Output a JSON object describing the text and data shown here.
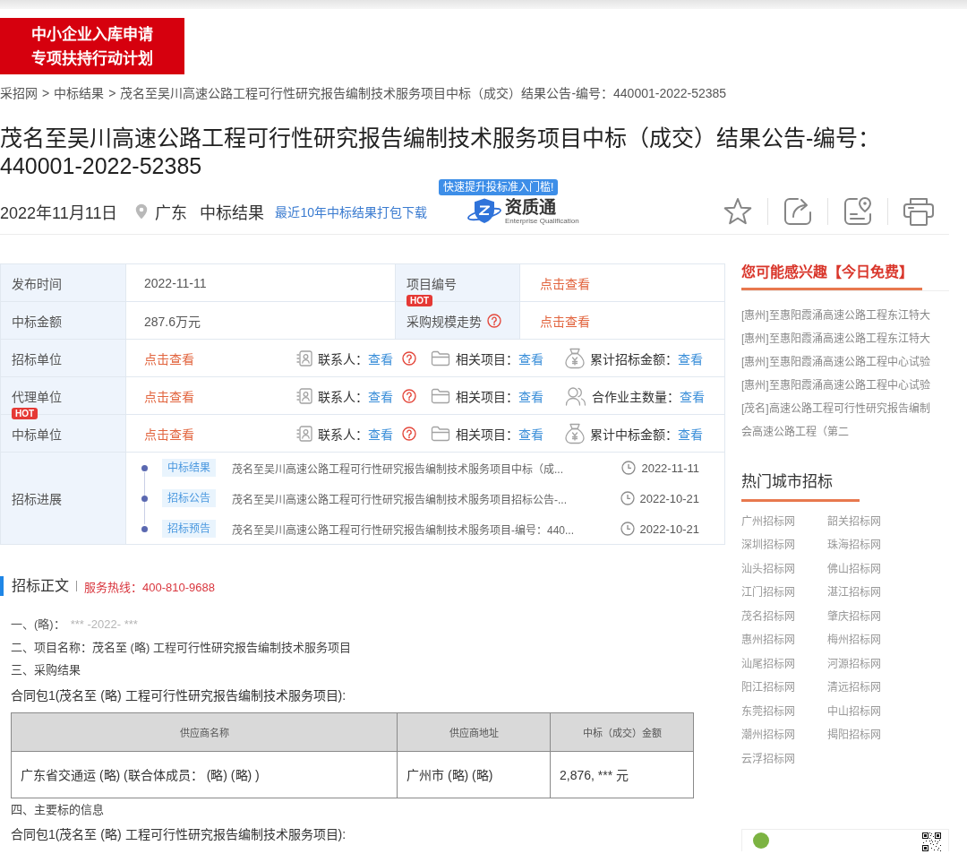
{
  "promo_banner": {
    "lines": [
      "中小企业入库申请",
      "专项扶持行动计划"
    ]
  },
  "breadcrumb": {
    "separator": ">",
    "items": [
      "采招网",
      "中标结果",
      "茂名至吴川高速公路工程可行性研究报告编制技术服务项目中标（成交）结果公告-编号：440001-2022-52385"
    ]
  },
  "title": "茂名至吴川高速公路工程可行性研究报告编制技术服务项目中标（成交）结果公告-编号：440001-2022-52385",
  "meta": {
    "date": "2022年11月11日",
    "region": "广东",
    "category": "中标结果",
    "download_link": "最近10年中标结果打包下载",
    "partner": {
      "tooltip": "快速提升投标准入门槛!",
      "name": "资质通",
      "subtitle": "Enterprise Qualification"
    }
  },
  "info_table": {
    "top_rows": [
      {
        "label": "发布时间",
        "value": "2022-11-11",
        "label_2": "项目编号",
        "link_2": "点击查看"
      },
      {
        "label": "中标金额",
        "value": "287.6万元",
        "badge_2": "HOT",
        "label_2": "采购规模走势",
        "help_2": true,
        "link_2": "点击查看"
      }
    ],
    "party_rows": [
      {
        "label": "招标单位",
        "link": "点击查看",
        "contact": {
          "label": "联系人：",
          "link": "查看"
        },
        "related": {
          "label": "相关项目：",
          "link": "查看"
        },
        "stat": {
          "kind": "amount",
          "label": "累计招标金额：",
          "link": "查看"
        }
      },
      {
        "label": "代理单位",
        "link": "点击查看",
        "contact": {
          "label": "联系人：",
          "link": "查看"
        },
        "related": {
          "label": "相关项目：",
          "link": "查看"
        },
        "stat": {
          "kind": "owners",
          "label": "合作业主数量：",
          "link": "查看"
        }
      },
      {
        "badge": "HOT",
        "label": "中标单位",
        "link": "点击查看",
        "contact": {
          "label": "联系人：",
          "link": "查看"
        },
        "related": {
          "label": "相关项目：",
          "link": "查看"
        },
        "stat": {
          "kind": "amount",
          "label": "累计中标金额：",
          "link": "查看"
        }
      }
    ],
    "progress": {
      "label": "招标进展",
      "items": [
        {
          "tag": "中标结果",
          "text": "茂名至吴川高速公路工程可行性研究报告编制技术服务项目中标（成...",
          "date": "2022-11-11"
        },
        {
          "tag": "招标公告",
          "text": "茂名至吴川高速公路工程可行性研究报告编制技术服务项目招标公告-...",
          "date": "2022-10-21"
        },
        {
          "tag": "招标预告",
          "text": "茂名至吴川高速公路工程可行性研究报告编制技术服务项目-编号：440...",
          "date": "2022-10-21"
        }
      ]
    }
  },
  "notice": {
    "heading": "招标正文",
    "hotline": "服务热线：400-810-9688",
    "blocks": [
      {
        "kind": "masked",
        "text": "一、(略)：",
        "masked": "*** -2022- ***"
      },
      {
        "kind": "line",
        "text": "二、项目名称：茂名至 (略) 工程可行性研究报告编制技术服务项目"
      },
      {
        "kind": "line",
        "text": "三、采购结果"
      },
      {
        "kind": "package",
        "text": "合同包1(茂名至 (略) 工程可行性研究报告编制技术服务项目):"
      },
      {
        "kind": "table",
        "columns": [
          "供应商名称",
          "供应商地址",
          "中标（成交）金额"
        ],
        "rows": [
          [
            "广东省交通运 (略) (联合体成员： (略) (略) )",
            "广州市 (略) (略)",
            "2,876, *** 元"
          ]
        ]
      },
      {
        "kind": "line",
        "text": "四、主要标的信息"
      },
      {
        "kind": "package",
        "text": "合同包1(茂名至 (略) 工程可行性研究报告编制技术服务项目):"
      }
    ]
  },
  "sidebar": {
    "recommend": {
      "title": "您可能感兴趣【今日免费】",
      "items": [
        "[惠州]至惠阳霞涌高速公路工程东江特大",
        "[惠州]至惠阳霞涌高速公路工程东江特大",
        "[惠州]至惠阳霞涌高速公路工程中心试验",
        "[惠州]至惠阳霞涌高速公路工程中心试验",
        "[茂名]高速公路工程可行性研究报告编制",
        "会高速公路工程（第二"
      ]
    },
    "hot_cities": {
      "title": "热门城市招标",
      "items": [
        "广州招标网",
        "韶关招标网",
        "深圳招标网",
        "珠海招标网",
        "汕头招标网",
        "佛山招标网",
        "江门招标网",
        "湛江招标网",
        "茂名招标网",
        "肇庆招标网",
        "惠州招标网",
        "梅州招标网",
        "汕尾招标网",
        "河源招标网",
        "阳江招标网",
        "清远招标网",
        "东莞招标网",
        "中山招标网",
        "潮州招标网",
        "揭阳招标网",
        "云浮招标网"
      ]
    }
  }
}
